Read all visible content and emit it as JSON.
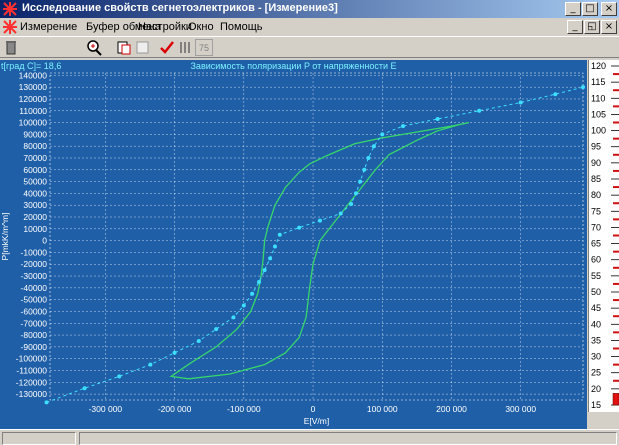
{
  "window": {
    "title": "Исследование свойств сегнетоэлектриков - [Измерение3]",
    "caption_buttons": {
      "minimize": "_",
      "maximize": "□",
      "close": "×"
    }
  },
  "menu": {
    "items": [
      "Измерение",
      "Буфер обмена",
      "Настройки",
      "Окно",
      "Помощь"
    ],
    "child_buttons": {
      "minimize": "_",
      "restore": "◱",
      "close": "×"
    }
  },
  "toolbar": {
    "count_label": "75",
    "icons": [
      "trash-icon",
      "magnifier-icon",
      "copy-clipboard-icon",
      "print-icon",
      "checkmark-icon",
      "lines-icon",
      "counter-field"
    ]
  },
  "readout": {
    "temperature": "t[град C]= 18,6"
  },
  "colors": {
    "plot_background": "#1f5fa7",
    "grid": "#ffffff",
    "hysteresis_loop": "#37d66b",
    "dotted_trace": "#3ddfff",
    "gauge_tick_red": "#cc1111",
    "gauge_fill_red": "#e01010"
  },
  "chart_data": {
    "type": "line",
    "title": "Зависимость поляризации P от напряженности E",
    "xlabel": "E[V/m]",
    "ylabel": "P[mkK/m^m]",
    "xlim": [
      -380000,
      390000
    ],
    "ylim": [
      -135000,
      142000
    ],
    "x_ticks": [
      -300000,
      -200000,
      -100000,
      0,
      100000,
      200000,
      300000
    ],
    "x_tick_labels": [
      "-300 000",
      "-200 000",
      "-100 000",
      "0",
      "100 000",
      "200 000",
      "300 000"
    ],
    "y_ticks": [
      140000,
      130000,
      120000,
      110000,
      100000,
      90000,
      80000,
      70000,
      60000,
      50000,
      40000,
      30000,
      20000,
      10000,
      0,
      -10000,
      -20000,
      -30000,
      -40000,
      -50000,
      -60000,
      -70000,
      -80000,
      -90000,
      -100000,
      -110000,
      -120000,
      -130000
    ],
    "y_tick_labels": [
      "140000",
      "130000",
      "120000",
      "110000",
      "100000",
      "90000",
      "80000",
      "70000",
      "60000",
      "50000",
      "40000",
      "30000",
      "20000",
      "10000",
      "0",
      "-10000",
      "-20000",
      "-30000",
      "-40000",
      "-50000",
      "-60000",
      "-70000",
      "-80000",
      "-90000",
      "-100000",
      "-110000",
      "-120000",
      "-130000"
    ],
    "grid": true,
    "series": [
      {
        "style": "hysteresis-loop",
        "points": [
          [
            225000,
            100000
          ],
          [
            200000,
            97000
          ],
          [
            150000,
            92000
          ],
          [
            100000,
            87000
          ],
          [
            60000,
            82000
          ],
          [
            20000,
            72000
          ],
          [
            -5000,
            65000
          ],
          [
            -20000,
            58000
          ],
          [
            -40000,
            45000
          ],
          [
            -55000,
            30000
          ],
          [
            -65000,
            12000
          ],
          [
            -70000,
            0
          ],
          [
            -72000,
            -15000
          ],
          [
            -75000,
            -30000
          ],
          [
            -80000,
            -45000
          ],
          [
            -90000,
            -60000
          ],
          [
            -110000,
            -75000
          ],
          [
            -140000,
            -90000
          ],
          [
            -175000,
            -103000
          ],
          [
            -205000,
            -115000
          ],
          [
            -180000,
            -117000
          ],
          [
            -120000,
            -113000
          ],
          [
            -70000,
            -105000
          ],
          [
            -40000,
            -95000
          ],
          [
            -20000,
            -82000
          ],
          [
            -10000,
            -65000
          ],
          [
            -5000,
            -40000
          ],
          [
            0,
            -20000
          ],
          [
            10000,
            0
          ],
          [
            30000,
            15000
          ],
          [
            50000,
            30000
          ],
          [
            70000,
            45000
          ],
          [
            90000,
            60000
          ],
          [
            110000,
            73000
          ],
          [
            150000,
            85000
          ],
          [
            180000,
            93000
          ],
          [
            210000,
            98000
          ],
          [
            225000,
            100000
          ]
        ]
      },
      {
        "style": "dotted-trace",
        "points": [
          [
            -385000,
            -137000
          ],
          [
            -330000,
            -125000
          ],
          [
            -280000,
            -115000
          ],
          [
            -235000,
            -105000
          ],
          [
            -200000,
            -95000
          ],
          [
            -165000,
            -85000
          ],
          [
            -140000,
            -75000
          ],
          [
            -115000,
            -65000
          ],
          [
            -100000,
            -55000
          ],
          [
            -88000,
            -45000
          ],
          [
            -78000,
            -35000
          ],
          [
            -70000,
            -25000
          ],
          [
            -62000,
            -15000
          ],
          [
            -55000,
            -5000
          ],
          [
            -48000,
            5000
          ],
          [
            -20000,
            11000
          ],
          [
            10000,
            17000
          ],
          [
            40000,
            23000
          ],
          [
            55000,
            31000
          ],
          [
            62000,
            40000
          ],
          [
            68000,
            50000
          ],
          [
            74000,
            60000
          ],
          [
            80000,
            70000
          ],
          [
            88000,
            80000
          ],
          [
            100000,
            90000
          ],
          [
            130000,
            97000
          ],
          [
            180000,
            103000
          ],
          [
            240000,
            110000
          ],
          [
            300000,
            117000
          ],
          [
            350000,
            124000
          ],
          [
            390000,
            130000
          ]
        ]
      }
    ]
  },
  "gauge": {
    "labels": [
      "120",
      "115",
      "110",
      "105",
      "100",
      "95",
      "90",
      "85",
      "80",
      "75",
      "70",
      "65",
      "60",
      "55",
      "50",
      "45",
      "40",
      "35",
      "30",
      "25",
      "20",
      "15"
    ],
    "min": 15,
    "max": 120,
    "value": 18.6
  }
}
